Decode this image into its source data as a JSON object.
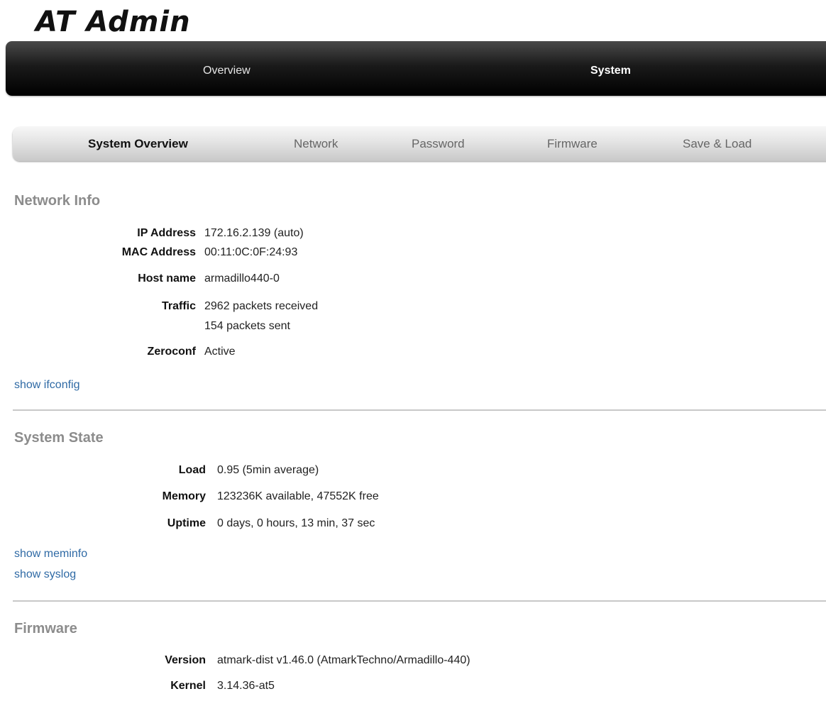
{
  "app": {
    "title": "AT Admin"
  },
  "main_nav": {
    "tabs": [
      {
        "label": "Overview",
        "active": false
      },
      {
        "label": "System",
        "active": true
      }
    ]
  },
  "sub_nav": {
    "tabs": [
      {
        "label": "System Overview",
        "active": true
      },
      {
        "label": "Network",
        "active": false
      },
      {
        "label": "Password",
        "active": false
      },
      {
        "label": "Firmware",
        "active": false
      },
      {
        "label": "Save & Load",
        "active": false
      }
    ]
  },
  "network_info": {
    "title": "Network Info",
    "ip_label": "IP Address",
    "ip_value": "172.16.2.139 (auto)",
    "mac_label": "MAC Address",
    "mac_value": "00:11:0C:0F:24:93",
    "host_label": "Host name",
    "host_value": "armadillo440-0",
    "traffic_label": "Traffic",
    "traffic_received": "2962 packets received",
    "traffic_sent": "154 packets sent",
    "zeroconf_label": "Zeroconf",
    "zeroconf_value": "Active",
    "link": "show ifconfig"
  },
  "system_state": {
    "title": "System State",
    "load_label": "Load",
    "load_value": "0.95 (5min average)",
    "memory_label": "Memory",
    "memory_value": "123236K available, 47552K free",
    "uptime_label": "Uptime",
    "uptime_value": "0 days, 0 hours, 13 min, 37 sec",
    "link_meminfo": "show meminfo",
    "link_syslog": "show syslog"
  },
  "firmware": {
    "title": "Firmware",
    "version_label": "Version",
    "version_value": "atmark-dist v1.46.0 (AtmarkTechno/Armadillo-440)",
    "kernel_label": "Kernel",
    "kernel_value": "3.14.36-at5"
  },
  "colors": {
    "link": "#2f6aa5",
    "section_title": "#8c8c8c",
    "nav_bg": "#000000"
  }
}
